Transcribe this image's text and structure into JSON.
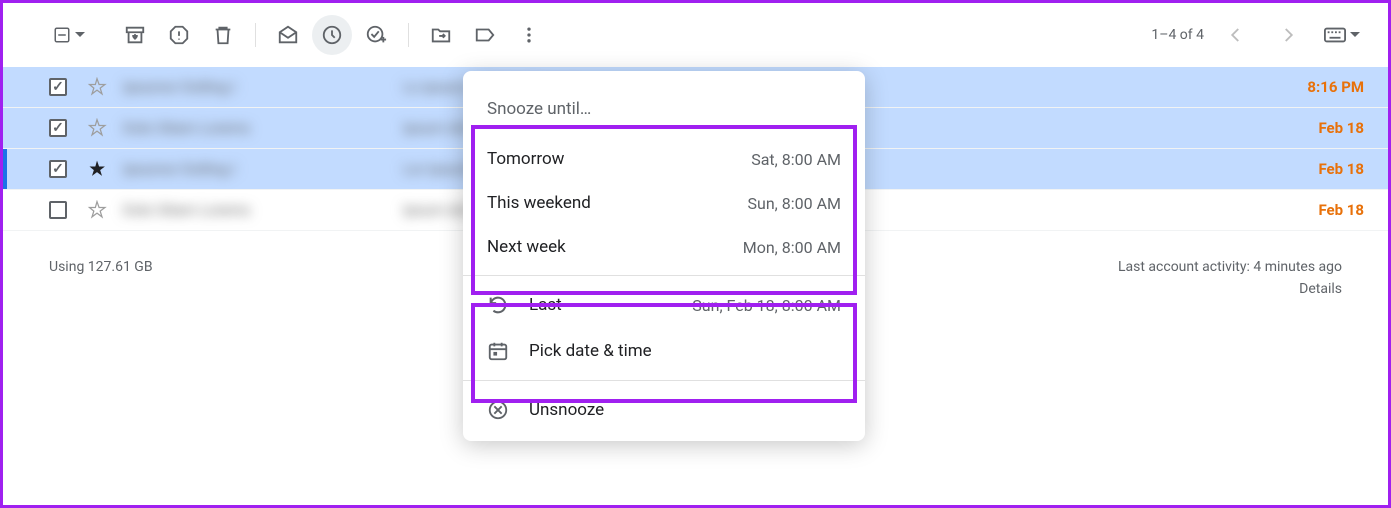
{
  "toolbar": {
    "pagination": "1–4 of 4"
  },
  "emails": [
    {
      "sender_blur": "Ipsumor Dolling I",
      "subject_blur": "Lo ipsum I'd Dolor Sitamet",
      "time": "8:16 PM",
      "selected": true,
      "checked": true,
      "starred": false,
      "current": false
    },
    {
      "sender_blur": "Dolo Sitam Lorems",
      "subject_blur": "Ipsum dol s Ip. Dol si Amet Co",
      "time": "Feb 18",
      "selected": true,
      "checked": true,
      "starred": false,
      "current": false
    },
    {
      "sender_blur": "Ipsumor Dolling I",
      "subject_blur": "Lor Ipsumdol Sita Ametco Ad",
      "time": "Feb 18",
      "selected": true,
      "checked": true,
      "starred": true,
      "current": true
    },
    {
      "sender_blur": "Dolo Sitam Lorems",
      "subject_blur": "Ipsum dol s Ip. D'Amet co Adip E",
      "time": "Feb 18",
      "selected": false,
      "checked": false,
      "starred": false,
      "current": false
    }
  ],
  "footer": {
    "storage": "Using 127.61 GB",
    "activity": "Last account activity: 4 minutes ago",
    "details": "Details"
  },
  "snooze": {
    "title": "Snooze until…",
    "options": [
      {
        "label": "Tomorrow",
        "time": "Sat, 8:00 AM"
      },
      {
        "label": "This weekend",
        "time": "Sun, 8:00 AM"
      },
      {
        "label": "Next week",
        "time": "Mon, 8:00 AM"
      }
    ],
    "last": {
      "label": "Last",
      "time": "Sun, Feb 18, 8:00 AM"
    },
    "pick": "Pick date & time",
    "unsnooze": "Unsnooze"
  }
}
